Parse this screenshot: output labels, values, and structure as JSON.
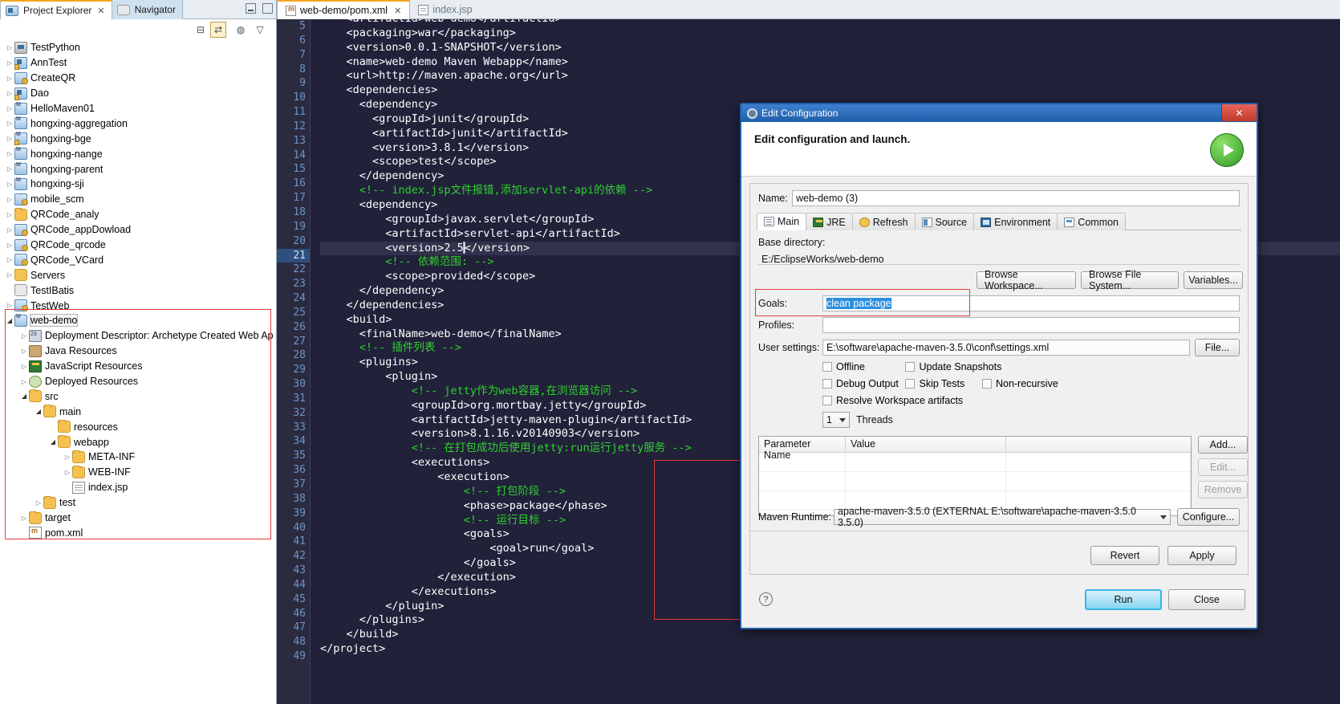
{
  "left_panel": {
    "tabs": [
      {
        "label": "Project Explorer",
        "icon": "project-explorer-icon",
        "close": "✕",
        "active": true
      },
      {
        "label": "Navigator",
        "icon": "navigator-icon",
        "active": false
      }
    ],
    "toolbar": [
      {
        "name": "collapse-all-icon",
        "glyph": "⊟"
      },
      {
        "name": "link-with-editor-icon",
        "glyph": "⇄"
      },
      {
        "name": "focus-icon",
        "glyph": "◍"
      },
      {
        "name": "view-menu-icon",
        "glyph": "▽"
      }
    ],
    "tree": [
      {
        "label": "TestPython",
        "indent": 0,
        "arrow": "closed",
        "icon": "python-project-icon"
      },
      {
        "label": "AnnTest",
        "indent": 0,
        "arrow": "closed",
        "icon": "java-project-icon",
        "lock": true
      },
      {
        "label": "CreateQR",
        "indent": 0,
        "arrow": "closed",
        "icon": "web-project-icon"
      },
      {
        "label": "Dao",
        "indent": 0,
        "arrow": "closed",
        "icon": "java-project-icon",
        "lock": true
      },
      {
        "label": "HelloMaven01",
        "indent": 0,
        "arrow": "closed",
        "icon": "maven-project-icon"
      },
      {
        "label": "hongxing-aggregation",
        "indent": 0,
        "arrow": "closed",
        "icon": "maven-project-icon"
      },
      {
        "label": "hongxing-bge",
        "indent": 0,
        "arrow": "closed",
        "icon": "maven-project-icon",
        "lock": true
      },
      {
        "label": "hongxing-nange",
        "indent": 0,
        "arrow": "closed",
        "icon": "maven-project-icon"
      },
      {
        "label": "hongxing-parent",
        "indent": 0,
        "arrow": "closed",
        "icon": "maven-project-icon"
      },
      {
        "label": "hongxing-sji",
        "indent": 0,
        "arrow": "closed",
        "icon": "maven-project-icon"
      },
      {
        "label": "mobile_scm",
        "indent": 0,
        "arrow": "closed",
        "icon": "web-project-icon"
      },
      {
        "label": "QRCode_analy",
        "indent": 0,
        "arrow": "closed",
        "icon": "folder-project-icon"
      },
      {
        "label": "QRCode_appDowload",
        "indent": 0,
        "arrow": "closed",
        "icon": "web-project-icon"
      },
      {
        "label": "QRCode_qrcode",
        "indent": 0,
        "arrow": "closed",
        "icon": "web-project-icon"
      },
      {
        "label": "QRCode_VCard",
        "indent": 0,
        "arrow": "closed",
        "icon": "web-project-icon"
      },
      {
        "label": "Servers",
        "indent": 0,
        "arrow": "closed",
        "icon": "server-folder-icon"
      },
      {
        "label": "TestIBatis",
        "indent": 0,
        "arrow": "none",
        "icon": "closed-project-icon"
      },
      {
        "label": "TestWeb",
        "indent": 0,
        "arrow": "closed",
        "icon": "web-project-icon"
      },
      {
        "label": "web-demo",
        "indent": 0,
        "arrow": "open",
        "icon": "maven-web-project-icon",
        "selected": true
      },
      {
        "label": "Deployment Descriptor: Archetype Created Web Ap",
        "indent": 1,
        "arrow": "closed",
        "icon": "deployment-descriptor-icon"
      },
      {
        "label": "Java Resources",
        "indent": 1,
        "arrow": "closed",
        "icon": "java-resources-icon"
      },
      {
        "label": "JavaScript Resources",
        "indent": 1,
        "arrow": "closed",
        "icon": "javascript-resources-icon"
      },
      {
        "label": "Deployed Resources",
        "indent": 1,
        "arrow": "closed",
        "icon": "deployed-resources-icon"
      },
      {
        "label": "src",
        "indent": 1,
        "arrow": "open",
        "icon": "folder-icon"
      },
      {
        "label": "main",
        "indent": 2,
        "arrow": "open",
        "icon": "folder-icon"
      },
      {
        "label": "resources",
        "indent": 3,
        "arrow": "none",
        "icon": "folder-icon"
      },
      {
        "label": "webapp",
        "indent": 3,
        "arrow": "open",
        "icon": "folder-icon"
      },
      {
        "label": "META-INF",
        "indent": 4,
        "arrow": "closed",
        "icon": "folder-icon"
      },
      {
        "label": "WEB-INF",
        "indent": 4,
        "arrow": "closed",
        "icon": "folder-icon"
      },
      {
        "label": "index.jsp",
        "indent": 4,
        "arrow": "none",
        "icon": "jsp-file-icon"
      },
      {
        "label": "test",
        "indent": 2,
        "arrow": "closed",
        "icon": "folder-icon"
      },
      {
        "label": "target",
        "indent": 1,
        "arrow": "closed",
        "icon": "folder-icon"
      },
      {
        "label": "pom.xml",
        "indent": 1,
        "arrow": "none",
        "icon": "pom-file-icon"
      }
    ]
  },
  "editor": {
    "tabs": [
      {
        "label": "web-demo/pom.xml",
        "icon": "maven-pom-icon",
        "close": "✕",
        "active": true
      },
      {
        "label": "index.jsp",
        "icon": "jsp-file-icon",
        "active": false
      }
    ],
    "first_line_number": 5,
    "current_line": 21,
    "lines": [
      {
        "n": 5,
        "text": "    <artifactId>web-demo</artifactId>",
        "kind": "tag",
        "clipped": true
      },
      {
        "n": 6,
        "text": "    <packaging>war</packaging>",
        "kind": "tag"
      },
      {
        "n": 7,
        "text": "    <version>0.0.1-SNAPSHOT</version>",
        "kind": "tag"
      },
      {
        "n": 8,
        "text": "    <name>web-demo Maven Webapp</name>",
        "kind": "tag"
      },
      {
        "n": 9,
        "text": "    <url>http://maven.apache.org</url>",
        "kind": "tag"
      },
      {
        "n": 10,
        "text": "    <dependencies>",
        "kind": "tag",
        "fold": true
      },
      {
        "n": 11,
        "text": "      <dependency>",
        "kind": "tag",
        "fold": true
      },
      {
        "n": 12,
        "text": "        <groupId>junit</groupId>",
        "kind": "tag"
      },
      {
        "n": 13,
        "text": "        <artifactId>junit</artifactId>",
        "kind": "tag"
      },
      {
        "n": 14,
        "text": "        <version>3.8.1</version>",
        "kind": "tag"
      },
      {
        "n": 15,
        "text": "        <scope>test</scope>",
        "kind": "tag"
      },
      {
        "n": 16,
        "text": "      </dependency>",
        "kind": "tag"
      },
      {
        "n": 17,
        "text": "      <!-- index.jsp文件报错,添加servlet-api的依赖 -->",
        "kind": "comment"
      },
      {
        "n": 18,
        "text": "      <dependency>",
        "kind": "tag",
        "fold": true
      },
      {
        "n": 19,
        "text": "          <groupId>javax.servlet</groupId>",
        "kind": "tag"
      },
      {
        "n": 20,
        "text": "          <artifactId>servlet-api</artifactId>",
        "kind": "tag"
      },
      {
        "n": 21,
        "text": "          <version>2.5</version>",
        "kind": "tag",
        "caret_after": "          <version>2.5"
      },
      {
        "n": 22,
        "text": "          <!-- 依赖范围: -->",
        "kind": "comment"
      },
      {
        "n": 23,
        "text": "          <scope>provided</scope>",
        "kind": "tag"
      },
      {
        "n": 24,
        "text": "      </dependency>",
        "kind": "tag"
      },
      {
        "n": 25,
        "text": "    </dependencies>",
        "kind": "tag"
      },
      {
        "n": 26,
        "text": "    <build>",
        "kind": "tag",
        "fold": true
      },
      {
        "n": 27,
        "text": "      <finalName>web-demo</finalName>",
        "kind": "tag"
      },
      {
        "n": 28,
        "text": "      <!-- 插件列表 -->",
        "kind": "comment",
        "fold": true
      },
      {
        "n": 29,
        "text": "      <plugins>",
        "kind": "tag",
        "fold": true
      },
      {
        "n": 30,
        "text": "          <plugin>",
        "kind": "tag",
        "fold": true
      },
      {
        "n": 31,
        "text": "              <!-- jetty作为web容器,在浏览器访问 -->",
        "kind": "comment"
      },
      {
        "n": 32,
        "text": "              <groupId>org.mortbay.jetty</groupId>",
        "kind": "tag",
        "fold": true
      },
      {
        "n": 33,
        "text": "              <artifactId>jetty-maven-plugin</artifactId>",
        "kind": "tag"
      },
      {
        "n": 34,
        "text": "              <version>8.1.16.v20140903</version>",
        "kind": "tag"
      },
      {
        "n": 35,
        "text": "              <!-- 在打包成功后使用jetty:run运行jetty服务 -->",
        "kind": "comment"
      },
      {
        "n": 36,
        "text": "              <executions>",
        "kind": "tag",
        "fold": true
      },
      {
        "n": 37,
        "text": "                  <execution>",
        "kind": "tag",
        "fold": true
      },
      {
        "n": 38,
        "text": "                      <!-- 打包阶段 -->",
        "kind": "comment"
      },
      {
        "n": 39,
        "text": "                      <phase>package</phase>",
        "kind": "tag"
      },
      {
        "n": 40,
        "text": "                      <!-- 运行目标 -->",
        "kind": "comment"
      },
      {
        "n": 41,
        "text": "                      <goals>",
        "kind": "tag",
        "fold": true
      },
      {
        "n": 42,
        "text": "                          <goal>run</goal>",
        "kind": "tag"
      },
      {
        "n": 43,
        "text": "                      </goals>",
        "kind": "tag"
      },
      {
        "n": 44,
        "text": "                  </execution>",
        "kind": "tag"
      },
      {
        "n": 45,
        "text": "              </executions>",
        "kind": "tag"
      },
      {
        "n": 46,
        "text": "          </plugin>",
        "kind": "tag"
      },
      {
        "n": 47,
        "text": "      </plugins>",
        "kind": "tag"
      },
      {
        "n": 48,
        "text": "    </build>",
        "kind": "tag"
      },
      {
        "n": 49,
        "text": "</project>",
        "kind": "tag"
      }
    ]
  },
  "dialog": {
    "title": "Edit Configuration",
    "close_label": "✕",
    "heading": "Edit configuration and launch.",
    "run_icon": "run-green-play-icon",
    "name_label": "Name:",
    "name_value": "web-demo (3)",
    "tabs": [
      {
        "label": "Main",
        "icon": "main-tab-icon",
        "active": true
      },
      {
        "label": "JRE",
        "icon": "jre-tab-icon",
        "active": false
      },
      {
        "label": "Refresh",
        "icon": "refresh-tab-icon",
        "active": false
      },
      {
        "label": "Source",
        "icon": "source-tab-icon",
        "active": false
      },
      {
        "label": "Environment",
        "icon": "environment-tab-icon",
        "active": false
      },
      {
        "label": "Common",
        "icon": "common-tab-icon",
        "active": false
      }
    ],
    "base_directory_label": "Base directory:",
    "base_directory_value": "E:/EclipseWorks/web-demo",
    "browse_workspace": "Browse Workspace...",
    "browse_file_system": "Browse File System...",
    "variables": "Variables...",
    "goals_label": "Goals:",
    "goals_value": "clean package",
    "profiles_label": "Profiles:",
    "profiles_value": "",
    "user_settings_label": "User settings:",
    "user_settings_value": "E:\\software\\apache-maven-3.5.0\\conf\\settings.xml",
    "file_button": "File...",
    "checkboxes": [
      {
        "label": "Offline",
        "checked": false
      },
      {
        "label": "Update Snapshots",
        "checked": false
      },
      {
        "label": "Debug Output",
        "checked": false
      },
      {
        "label": "Skip Tests",
        "checked": false
      },
      {
        "label": "Non-recursive",
        "checked": false
      },
      {
        "label": "Resolve Workspace artifacts",
        "checked": false
      }
    ],
    "threads_value": "1",
    "threads_label": "Threads",
    "table": {
      "columns": [
        "Parameter Name",
        "Value"
      ],
      "rows": []
    },
    "add_button": "Add...",
    "edit_button": "Edit...",
    "remove_button": "Remove",
    "maven_runtime_label": "Maven Runtime:",
    "maven_runtime_value": "apache-maven-3.5.0 (EXTERNAL E:\\software\\apache-maven-3.5.0 3.5.0)",
    "configure_button": "Configure...",
    "revert_button": "Revert",
    "apply_button": "Apply",
    "help_icon": "help-question-icon",
    "run_button": "Run",
    "close_button": "Close"
  },
  "colors": {
    "accent_blue": "#1f5fa8",
    "selection_blue": "#2b8fe0",
    "highlight_red": "#e23b3b",
    "comment_green": "#2fd12f",
    "editor_bg": "#21213a",
    "run_green": "#2f9c22"
  }
}
